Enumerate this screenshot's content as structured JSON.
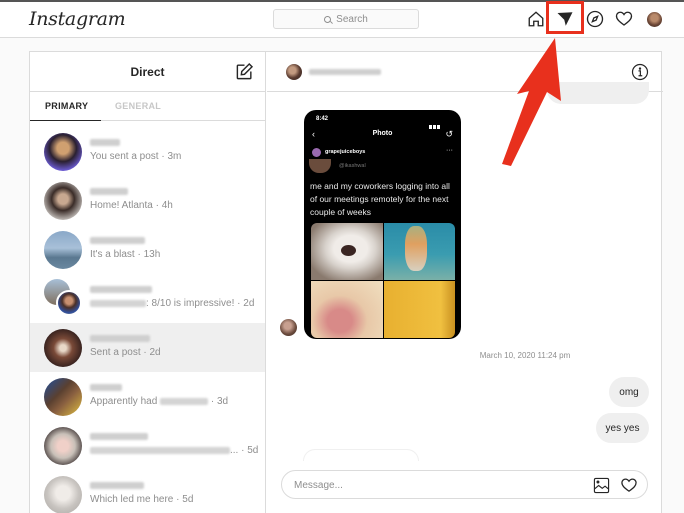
{
  "app": {
    "logo": "Instagram"
  },
  "navbar": {
    "search_placeholder": "Search",
    "icons": [
      "home-icon",
      "direct-icon",
      "explore-icon",
      "activity-heart-icon",
      "profile-avatar"
    ],
    "highlight_color": "#e8301d"
  },
  "direct": {
    "title": "Direct",
    "tabs": [
      {
        "label": "PRIMARY",
        "active": true
      },
      {
        "label": "GENERAL",
        "active": false
      }
    ],
    "threads": [
      {
        "preview": "You sent a post",
        "time": "3m",
        "active": false
      },
      {
        "preview": "Home! Atlanta",
        "time": "4h",
        "active": false
      },
      {
        "preview": "It's a blast",
        "time": "13h",
        "active": false
      },
      {
        "preview": ": 8/10 is impressive!",
        "time": "2d",
        "active": false,
        "group": true
      },
      {
        "preview": "Sent a post",
        "time": "2d",
        "active": true
      },
      {
        "preview": "Apparently had",
        "time": "3d",
        "active": false
      },
      {
        "preview": "...",
        "time": "5d",
        "active": false
      },
      {
        "preview": "Which led me here",
        "time": "5d",
        "active": false
      }
    ]
  },
  "chat": {
    "shared_post": {
      "status_time": "8:42",
      "screen_title": "Photo",
      "account": "grapejuiceboys",
      "handle": "@ikashwal",
      "caption": "me and my coworkers logging into all of our meetings remotely for the next couple of weeks"
    },
    "timestamp": "March 10, 2020 11:24 pm",
    "messages": [
      {
        "text": "omg",
        "from": "me"
      },
      {
        "text": "yes yes",
        "from": "me"
      }
    ],
    "composer_placeholder": "Message..."
  },
  "annotation": {
    "color": "#e8301d",
    "target": "direct-icon"
  }
}
